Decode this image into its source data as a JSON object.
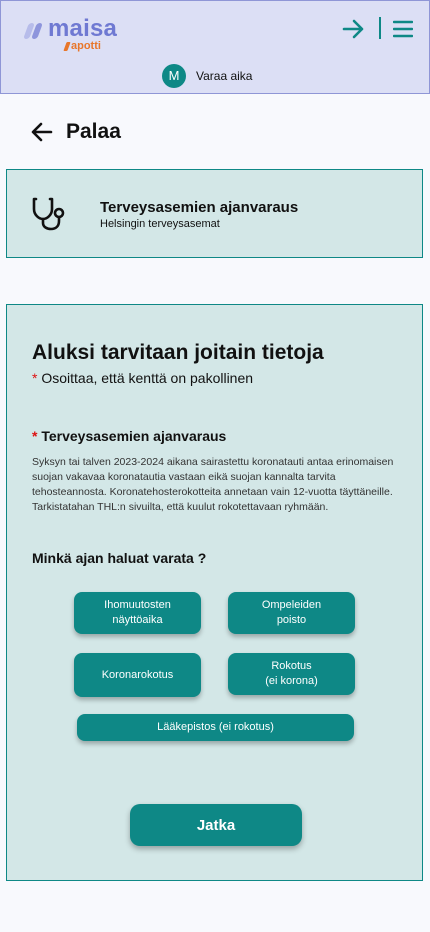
{
  "header": {
    "logo_text": "maisa",
    "logo_sub": "apotti",
    "avatar_initial": "M",
    "action_label": "Varaa aika",
    "icons": [
      "login-arrow-icon",
      "menu-icon"
    ]
  },
  "nav": {
    "back_label": "Palaa"
  },
  "service": {
    "title": "Terveysasemien ajanvaraus",
    "subtitle": "Helsingin terveysasemat",
    "icon": "stethoscope-icon"
  },
  "form": {
    "title": "Aluksi tarvitaan joitain tietoja",
    "required_star": "*",
    "required_note": "Osoittaa, että kenttä on pakollinen",
    "section_label": "Terveysasemien ajanvaraus",
    "section_description": "Syksyn tai talven 2023-2024 aikana sairastettu koronatauti antaa erinomaisen suojan vakavaa koronatautia vastaan eikä suojan kannalta tarvita tehosteannosta. Koronatehosterokotteita annetaan vain 12-vuotta täyttäneille. Tarkistatahan THL:n sivuilta, että kuulut rokotettavaan ryhmään.",
    "question": "Minkä ajan haluat varata ?",
    "options": [
      "Ihomuutosten\nnäyttöaika",
      "Ompeleiden\npoisto",
      "Koronarokotus",
      "Rokotus\n(ei korona)",
      "Lääkepistos (ei rokotus)"
    ],
    "continue_label": "Jatka"
  },
  "colors": {
    "teal": "#0e8886",
    "header_bg": "#dcdff5",
    "card_bg": "#d3e7e7",
    "logo_purple": "#6f79d2",
    "logo_orange": "#e8762a"
  }
}
